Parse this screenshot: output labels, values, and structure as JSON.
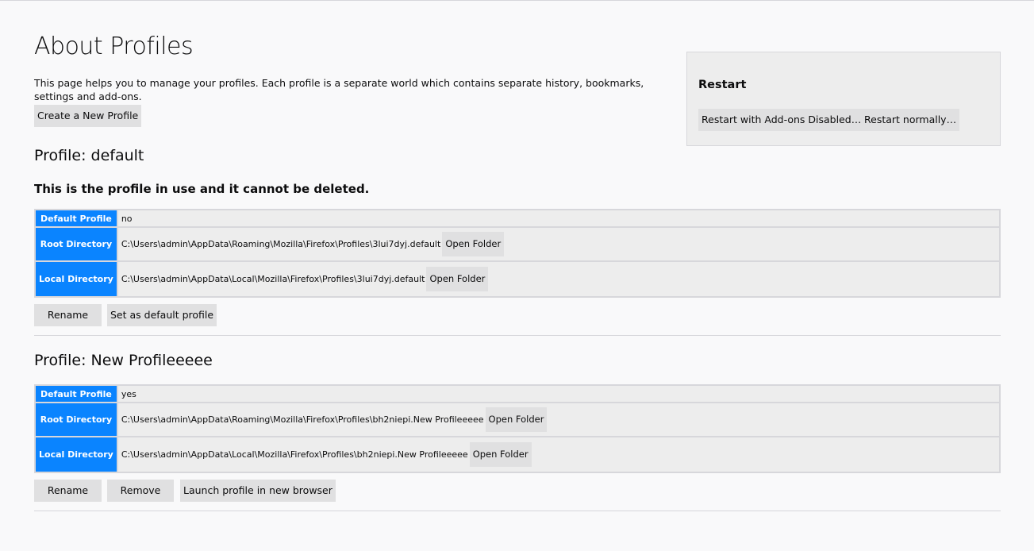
{
  "page": {
    "title": "About Profiles",
    "intro": "This page helps you to manage your profiles. Each profile is a separate world which contains separate history, bookmarks, settings and add-ons.",
    "create_button": "Create a New Profile"
  },
  "restart": {
    "heading": "Restart",
    "disabled_button": "Restart with Add-ons Disabled…",
    "normal_button": "Restart normally…"
  },
  "profiles": [
    {
      "heading": "Profile: default",
      "in_use_note": "This is the profile in use and it cannot be deleted.",
      "default_label": "Default Profile",
      "default_value": "no",
      "root_label": "Root Directory",
      "root_path": "C:\\Users\\admin\\AppData\\Roaming\\Mozilla\\Firefox\\Profiles\\3lui7dyj.default",
      "local_label": "Local Directory",
      "local_path": "C:\\Users\\admin\\AppData\\Local\\Mozilla\\Firefox\\Profiles\\3lui7dyj.default",
      "open_folder": "Open Folder",
      "rename": "Rename",
      "set_default": "Set as default profile"
    },
    {
      "heading": "Profile: New Profileeeee",
      "default_label": "Default Profile",
      "default_value": "yes",
      "root_label": "Root Directory",
      "root_path": "C:\\Users\\admin\\AppData\\Roaming\\Mozilla\\Firefox\\Profiles\\bh2niepi.New Profileeeee",
      "local_label": "Local Directory",
      "local_path": "C:\\Users\\admin\\AppData\\Local\\Mozilla\\Firefox\\Profiles\\bh2niepi.New Profileeeee",
      "open_folder": "Open Folder",
      "rename": "Rename",
      "remove": "Remove",
      "launch": "Launch profile in new browser"
    }
  ],
  "colors": {
    "header_cell": "#0a84ff",
    "background": "#f9f9fa",
    "button": "#e0e0e1"
  }
}
